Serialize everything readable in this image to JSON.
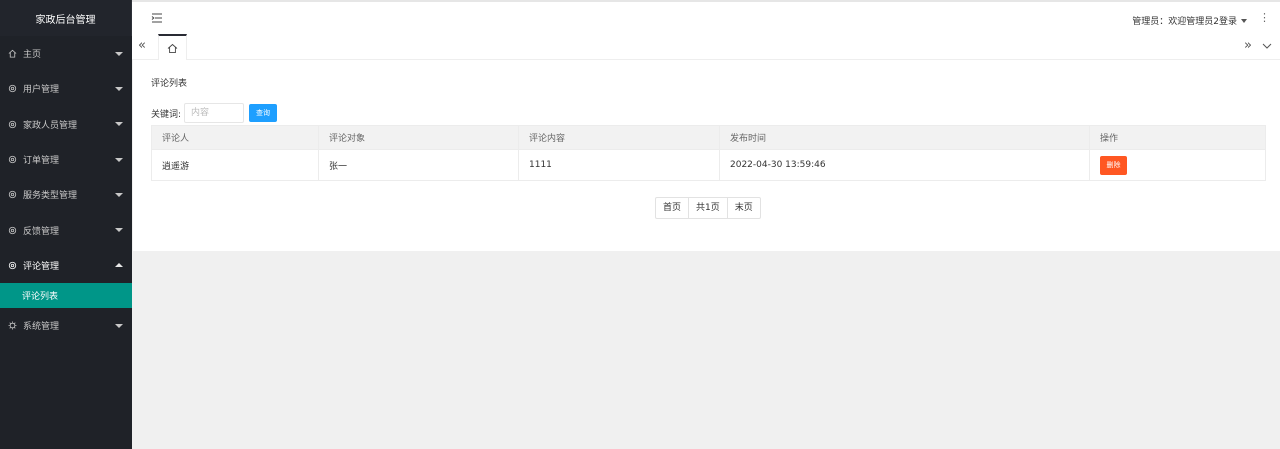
{
  "app": {
    "title": "家政后台管理"
  },
  "sidebar": {
    "items": [
      {
        "label": "主页",
        "icon": "home-icon"
      },
      {
        "label": "用户管理",
        "icon": "gear-icon"
      },
      {
        "label": "家政人员管理",
        "icon": "gear-icon"
      },
      {
        "label": "订单管理",
        "icon": "gear-icon"
      },
      {
        "label": "服务类型管理",
        "icon": "gear-icon"
      },
      {
        "label": "反馈管理",
        "icon": "gear-icon"
      },
      {
        "label": "评论管理",
        "icon": "gear-icon",
        "expanded": true
      },
      {
        "label": "系统管理",
        "icon": "settings-icon"
      }
    ],
    "sub_item": {
      "label": "评论列表",
      "parent": "评论管理",
      "active": true
    }
  },
  "header": {
    "admin_label": "管理员：欢迎管理员2登录"
  },
  "tabs": {
    "home_icon": "home-icon",
    "prev_icon": "double-chevron-left-icon",
    "next_icon": "double-chevron-right-icon"
  },
  "main": {
    "panel_title": "评论列表",
    "search": {
      "label": "关键词:",
      "placeholder": "内容",
      "value": "",
      "button_label": "查询"
    },
    "table": {
      "columns": [
        "评论人",
        "评论对象",
        "评论内容",
        "发布时间",
        "操作"
      ],
      "rows": [
        {
          "commenter": "逍遥游",
          "target": "张一",
          "content": "1111",
          "time": "2022-04-30 13:59:46",
          "action": "删除"
        }
      ]
    },
    "pagination": {
      "first": "首页",
      "total": "共1页",
      "last": "末页"
    }
  },
  "colors": {
    "sidebar": "#1f2228",
    "active": "#009688",
    "primary": "#1e9fff",
    "danger": "#ff5722"
  }
}
